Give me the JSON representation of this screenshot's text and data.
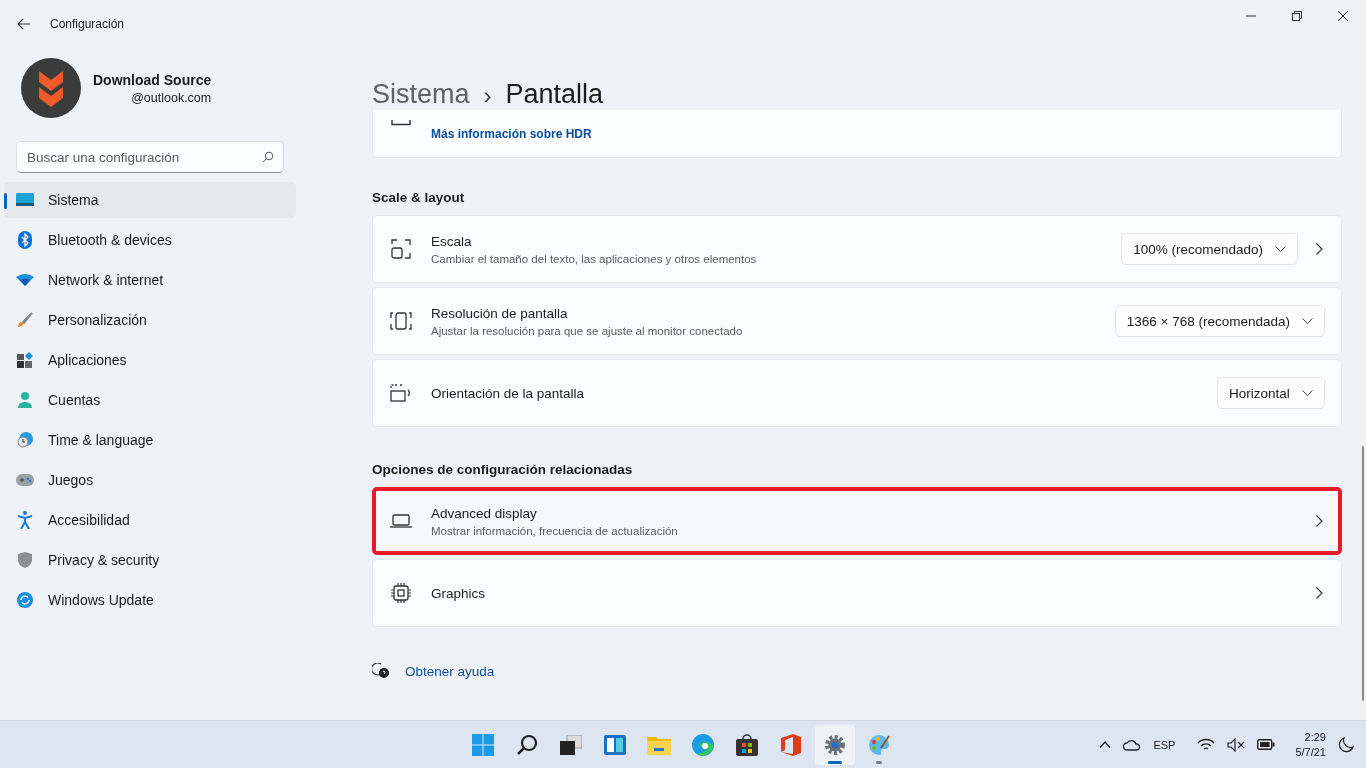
{
  "window": {
    "title": "Configuración"
  },
  "profile": {
    "name": "Download Source",
    "email": "@outlook.com"
  },
  "search": {
    "placeholder": "Buscar una configuración"
  },
  "nav": [
    {
      "label": "Sistema",
      "kind": "system",
      "selected": true
    },
    {
      "label": "Bluetooth & devices",
      "kind": "bluetooth",
      "selected": false
    },
    {
      "label": "Network & internet",
      "kind": "network",
      "selected": false
    },
    {
      "label": "Personalización",
      "kind": "brush",
      "selected": false
    },
    {
      "label": "Aplicaciones",
      "kind": "apps",
      "selected": false
    },
    {
      "label": "Cuentas",
      "kind": "person",
      "selected": false
    },
    {
      "label": "Time & language",
      "kind": "clock",
      "selected": false
    },
    {
      "label": "Juegos",
      "kind": "gamepad",
      "selected": false
    },
    {
      "label": "Accesibilidad",
      "kind": "access",
      "selected": false
    },
    {
      "label": "Privacy & security",
      "kind": "shield",
      "selected": false
    },
    {
      "label": "Windows Update",
      "kind": "update",
      "selected": false
    }
  ],
  "breadcrumb": {
    "parent": "Sistema",
    "separator": "›",
    "current": "Pantalla"
  },
  "cut_card": {
    "link": "Más información sobre HDR"
  },
  "sections": [
    {
      "title": "Scale & layout",
      "rows": [
        {
          "kind": "scale",
          "title": "Escala",
          "subtitle": "Cambiar el tamaño del texto, las aplicaciones y otros elementos",
          "dropdown": "100% (recomendado)",
          "chevron": true,
          "highlighted": false
        },
        {
          "kind": "resolution",
          "title": "Resolución de pantalla",
          "subtitle": "Ajustar la resolución para que se ajuste al monitor conectado",
          "dropdown": "1366 × 768 (recomendada)",
          "chevron": false,
          "highlighted": false
        },
        {
          "kind": "rotate",
          "title": "Orientación de la pantalla",
          "dropdown": "Horizontal",
          "chevron": false,
          "highlighted": false
        }
      ]
    },
    {
      "title": "Opciones de configuración relacionadas",
      "rows": [
        {
          "kind": "laptop",
          "title": "Advanced display",
          "subtitle": "Mostrar información, frecuencia de actualización",
          "chevron": true,
          "highlighted": true
        },
        {
          "kind": "chip",
          "title": "Graphics",
          "chevron": true,
          "highlighted": false
        }
      ]
    }
  ],
  "help": {
    "label": "Obtener ayuda"
  },
  "taskbar": {
    "apps": [
      {
        "kind": "start",
        "active": false,
        "running": false
      },
      {
        "kind": "search",
        "active": false,
        "running": false
      },
      {
        "kind": "taskview",
        "active": false,
        "running": false
      },
      {
        "kind": "widgets",
        "active": false,
        "running": false
      },
      {
        "kind": "folder",
        "active": false,
        "running": false
      },
      {
        "kind": "edge",
        "active": false,
        "running": false
      },
      {
        "kind": "store",
        "active": false,
        "running": false
      },
      {
        "kind": "office",
        "active": false,
        "running": false
      },
      {
        "kind": "settings",
        "active": true,
        "running": true
      },
      {
        "kind": "paint",
        "active": false,
        "running": true
      }
    ],
    "language": "ESP",
    "time": "2:29",
    "date": "5/7/21"
  }
}
